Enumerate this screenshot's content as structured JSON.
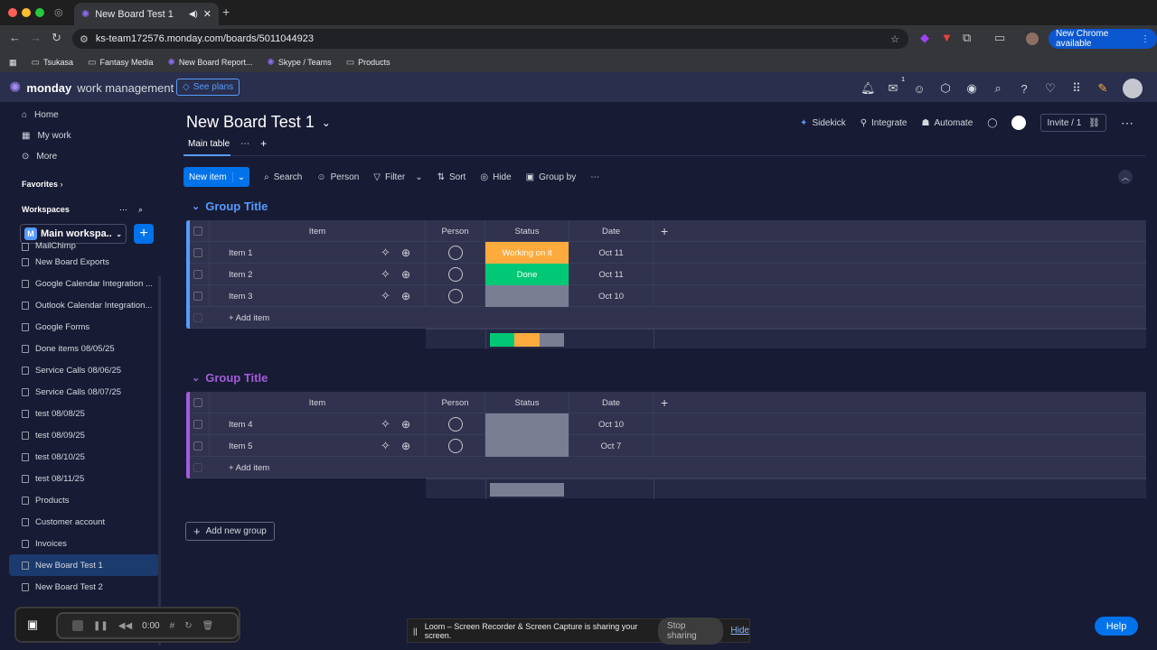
{
  "browser": {
    "tab_title": "New Board Test 1",
    "url": "ks-team172576.monday.com/boards/5011044923",
    "new_chrome_label": "New Chrome available",
    "bookmarks": [
      "Tsukasa",
      "Fantasy Media",
      "New Board Report...",
      "Skype / Teams",
      "Products"
    ]
  },
  "header": {
    "logo_bold": "monday",
    "logo_sub": "work management",
    "see_plans": "See plans",
    "inbox_count": "1"
  },
  "sidebar": {
    "nav": [
      {
        "label": "Home",
        "icon": "home-icon"
      },
      {
        "label": "My work",
        "icon": "calendar-icon"
      },
      {
        "label": "More",
        "icon": "more-icon"
      }
    ],
    "favorites_label": "Favorites",
    "workspaces_label": "Workspaces",
    "workspace_name": "Main workspa...",
    "workspace_initial": "M",
    "boards": [
      {
        "label": "MailChimp"
      },
      {
        "label": "New Board Exports"
      },
      {
        "label": "Google Calendar Integration ..."
      },
      {
        "label": "Outlook Calendar Integration..."
      },
      {
        "label": "Google Forms"
      },
      {
        "label": "Done items 08/05/25"
      },
      {
        "label": "Service Calls 08/06/25"
      },
      {
        "label": "Service Calls 08/07/25"
      },
      {
        "label": "test 08/08/25"
      },
      {
        "label": "test 08/09/25"
      },
      {
        "label": "test 08/10/25"
      },
      {
        "label": "test 08/11/25"
      },
      {
        "label": "Products"
      },
      {
        "label": "Customer account"
      },
      {
        "label": "Invoices"
      },
      {
        "label": "New Board Test 1",
        "active": true
      },
      {
        "label": "New Board Test 2"
      }
    ]
  },
  "board": {
    "title": "New Board Test 1",
    "view_tab": "Main table",
    "actions": {
      "sidekick": "Sidekick",
      "integrate": "Integrate",
      "automate": "Automate",
      "invite": "Invite / 1"
    },
    "toolbar": {
      "new_item": "New item",
      "search": "Search",
      "person": "Person",
      "filter": "Filter",
      "sort": "Sort",
      "hide": "Hide",
      "group_by": "Group by"
    },
    "columns": {
      "item": "Item",
      "person": "Person",
      "status": "Status",
      "date": "Date"
    },
    "add_item": "+ Add item",
    "add_group": "Add new group",
    "groups": [
      {
        "title": "Group Title",
        "color": "#579bfc",
        "rows": [
          {
            "name": "Item 1",
            "status": "Working on it",
            "status_color": "#fdab3d",
            "date": "Oct 11"
          },
          {
            "name": "Item 2",
            "status": "Done",
            "status_color": "#00c875",
            "date": "Oct 11"
          },
          {
            "name": "Item 3",
            "status": "",
            "status_color": "#797e93",
            "date": "Oct 10"
          }
        ],
        "summary": [
          {
            "color": "#00c875",
            "fraction": 0.333
          },
          {
            "color": "#fdab3d",
            "fraction": 0.333
          },
          {
            "color": "#797e93",
            "fraction": 0.334
          }
        ]
      },
      {
        "title": "Group Title",
        "color": "#a25ddc",
        "rows": [
          {
            "name": "Item 4",
            "status": "",
            "status_color": "#797e93",
            "date": "Oct 10"
          },
          {
            "name": "Item 5",
            "status": "",
            "status_color": "#797e93",
            "date": "Oct 7"
          }
        ],
        "summary": [
          {
            "color": "#797e93",
            "fraction": 1.0
          }
        ]
      }
    ]
  },
  "loom": {
    "timer": "0:00",
    "share_text": "Loom – Screen Recorder & Screen Capture is sharing your screen.",
    "stop_sharing": "Stop sharing",
    "hide": "Hide"
  },
  "help_label": "Help"
}
